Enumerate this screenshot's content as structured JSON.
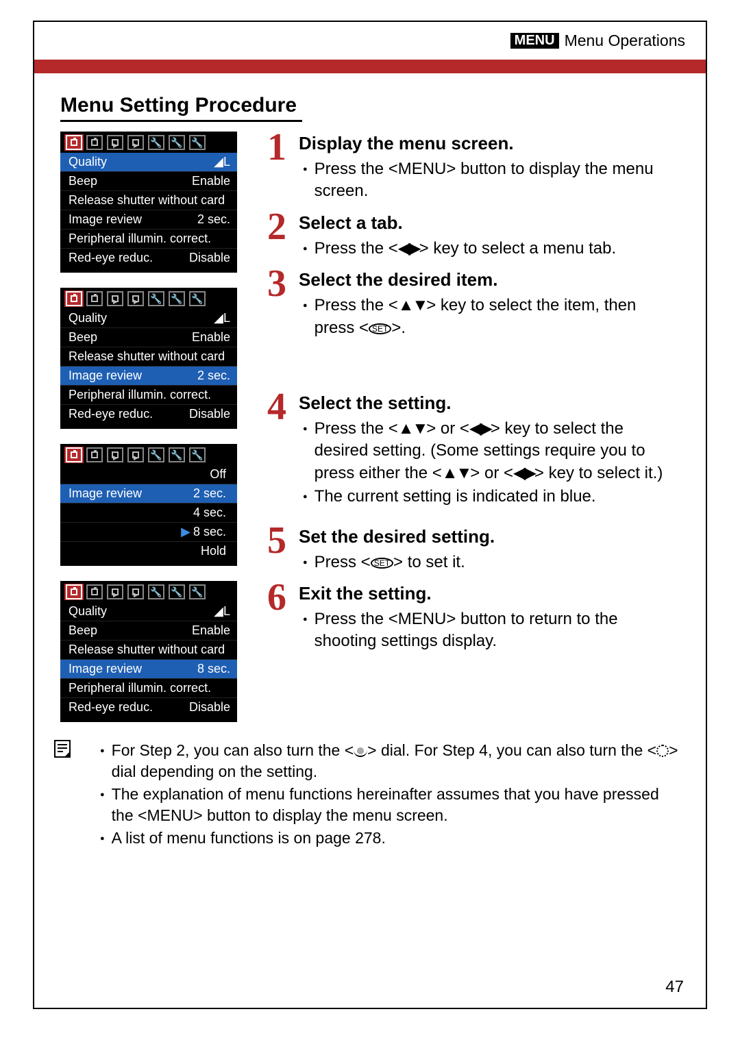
{
  "header": {
    "icon_text": "MENU",
    "title": "Menu Operations"
  },
  "section_title": "Menu Setting Procedure",
  "screenshots": {
    "s1": {
      "rows": [
        {
          "label": "Quality",
          "value": "◢L",
          "highlight": true
        },
        {
          "label": "Beep",
          "value": "Enable"
        },
        {
          "label": "Release shutter without card",
          "value": ""
        },
        {
          "label": "Image review",
          "value": "2 sec."
        },
        {
          "label": "Peripheral illumin. correct.",
          "value": ""
        },
        {
          "label": "Red-eye reduc.",
          "value": "Disable"
        }
      ]
    },
    "s2": {
      "rows": [
        {
          "label": "Quality",
          "value": "◢L"
        },
        {
          "label": "Beep",
          "value": "Enable"
        },
        {
          "label": "Release shutter without card",
          "value": ""
        },
        {
          "label": "Image review",
          "value": "2 sec.",
          "highlight": true
        },
        {
          "label": "Peripheral illumin. correct.",
          "value": ""
        },
        {
          "label": "Red-eye reduc.",
          "value": "Disable"
        }
      ]
    },
    "s3": {
      "label_row": "Image review",
      "options": [
        {
          "text": "Off"
        },
        {
          "text": "2 sec.",
          "current": true
        },
        {
          "text": "4 sec."
        },
        {
          "text": "8 sec.",
          "selected": true
        },
        {
          "text": "Hold"
        }
      ]
    },
    "s4": {
      "rows": [
        {
          "label": "Quality",
          "value": "◢L"
        },
        {
          "label": "Beep",
          "value": "Enable"
        },
        {
          "label": "Release shutter without card",
          "value": ""
        },
        {
          "label": "Image review",
          "value": "8 sec.",
          "highlight": true
        },
        {
          "label": "Peripheral illumin. correct.",
          "value": ""
        },
        {
          "label": "Red-eye reduc.",
          "value": "Disable"
        }
      ]
    }
  },
  "steps": {
    "1": {
      "title": "Display the menu screen.",
      "b1a": "Press the <",
      "b1b": "> button to display the menu screen.",
      "btn": "MENU"
    },
    "2": {
      "title": "Select a tab.",
      "b1a": "Press the <",
      "b1b": "> key to select a menu tab.",
      "key": "◀▶"
    },
    "3": {
      "title": "Select the desired item.",
      "b1a": "Press the <",
      "b1b": "> key to select the item, then press <",
      "b1c": ">.",
      "key": "▲▼",
      "set": "SET"
    },
    "4": {
      "title": "Select the setting.",
      "b1a": "Press the <",
      "b1b": "> or <",
      "b1c": "> key to select the desired setting. (Some settings require you to press either the <",
      "b1d": "> or <",
      "b1e": "> key to select it.)",
      "key1": "▲▼",
      "key2": "◀▶",
      "b2": "The current setting is indicated in blue."
    },
    "5": {
      "title": "Set the desired setting.",
      "b1a": "Press <",
      "b1b": "> to set it.",
      "set": "SET"
    },
    "6": {
      "title": "Exit the setting.",
      "b1a": "Press the <",
      "b1b": "> button to return to the shooting settings display.",
      "btn": "MENU"
    }
  },
  "footnotes": {
    "f1a": "For Step 2, you can also turn the <",
    "f1b": "> dial. For Step 4, you can also turn the <",
    "f1c": "> dial depending on the setting.",
    "f2a": "The explanation of menu functions hereinafter assumes that you have pressed the <",
    "f2b": "> button to display the menu screen.",
    "btn": "MENU",
    "f3": "A list of menu functions is on page 278."
  },
  "page_number": "47"
}
